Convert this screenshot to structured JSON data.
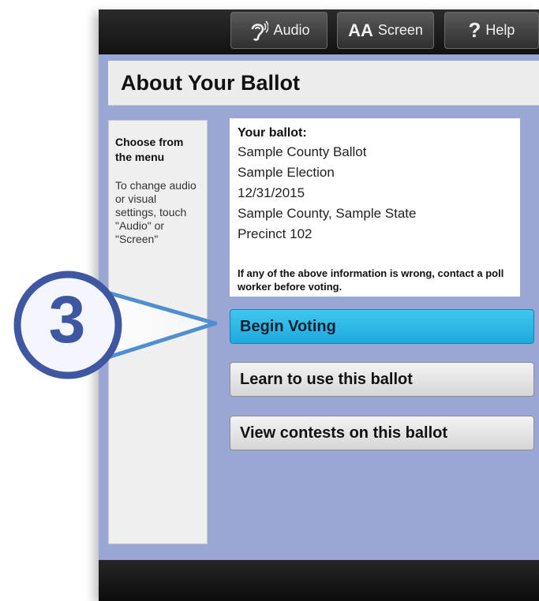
{
  "toolbar": {
    "audio": {
      "label": "Audio",
      "icon": "hearing-ear-icon"
    },
    "screen": {
      "icon_text": "AA",
      "label": "Screen"
    },
    "help": {
      "icon_text": "?",
      "label": "Help"
    }
  },
  "page_title": "About Your Ballot",
  "sidebar": {
    "heading": "Choose from the menu",
    "body": "To change audio or visual settings, touch \"Audio\" or \"Screen\""
  },
  "ballot_info": {
    "heading": "Your ballot:",
    "lines": [
      " Sample County Ballot",
      "Sample Election",
      "12/31/2015",
      "Sample County, Sample State",
      "Precinct 102"
    ],
    "warning": "If any of the above information is wrong, contact a poll worker before voting."
  },
  "actions": {
    "begin_voting": "Begin Voting",
    "learn": "Learn to use this ballot",
    "view_contests": "View contests on this ballot"
  },
  "callout": {
    "step_number": "3"
  },
  "colors": {
    "background": "#9aa6d3",
    "primary_button": "#2bb8e8",
    "callout": "#3f56a3"
  }
}
